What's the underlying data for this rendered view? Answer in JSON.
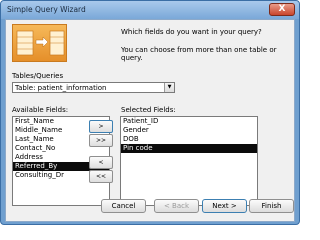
{
  "window": {
    "title": "Simple Query Wizard",
    "close_label": "X"
  },
  "prompt": {
    "line1": "Which fields do you want in your query?",
    "line2": "You can choose from more than one table or query."
  },
  "tables_queries": {
    "label": "Tables/Queries",
    "selected": "Table: patient_information"
  },
  "available_fields": {
    "label": "Available Fields:",
    "items": [
      "First_Name",
      "Middle_Name",
      "Last_Name",
      "Contact_No",
      "Address",
      "Referred_By",
      "Consulting_Dr"
    ],
    "selected_index": 5
  },
  "selected_fields": {
    "label": "Selected Fields:",
    "items": [
      "Patient_ID",
      "Gender",
      "DOB",
      "Pin code"
    ],
    "selected_index": 3
  },
  "move_buttons": {
    "add_one": ">",
    "add_all": ">>",
    "remove_one": "<",
    "remove_all": "<<"
  },
  "buttons": {
    "cancel": "Cancel",
    "back": "< Back",
    "next": "Next >",
    "finish": "Finish"
  },
  "colors": {
    "selection": "#0b0b0b",
    "art": "#e58f2a",
    "title_bar": "#7aa8d8"
  }
}
